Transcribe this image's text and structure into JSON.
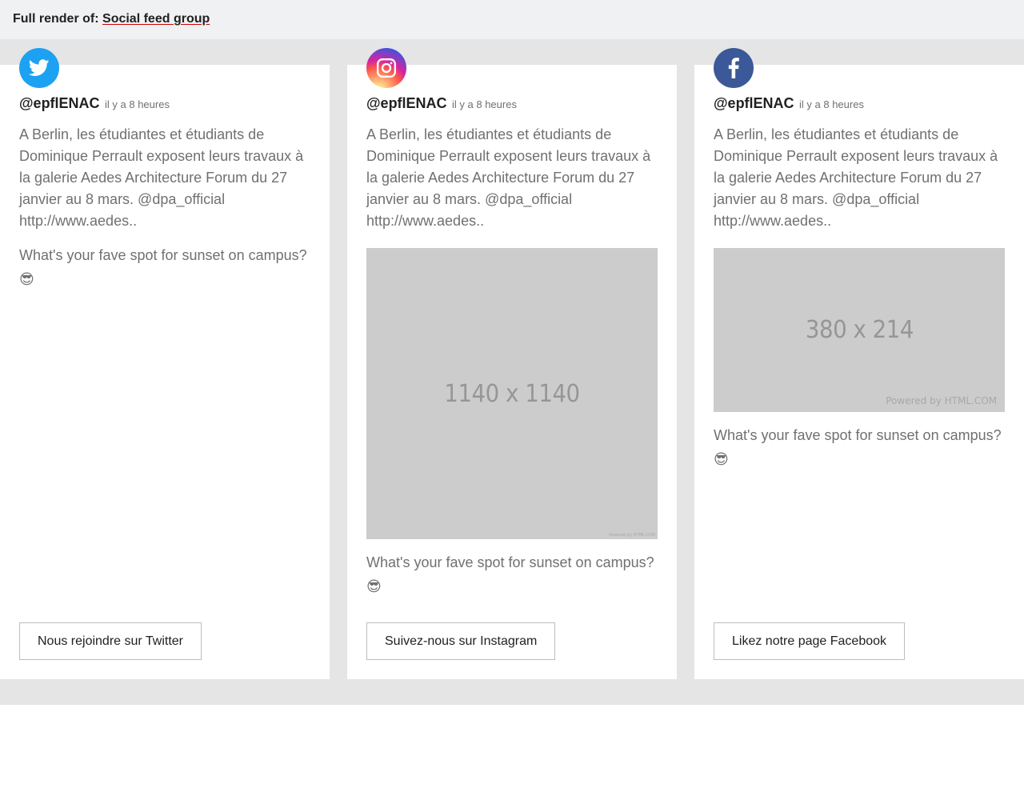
{
  "header": {
    "prefix": "Full render of:",
    "link": "Social feed group"
  },
  "cards": [
    {
      "network": "twitter",
      "handle": "@epflENAC",
      "time": "il y a 8 heures",
      "text": "A Berlin, les étudiantes et étudiants de Dominique Perrault exposent leurs travaux à la galerie Aedes Architecture Forum du 27 janvier au 8 mars. @dpa_official http://www.aedes..",
      "text2": "What's your fave spot for sunset on campus?",
      "button": "Nous rejoindre sur Twitter"
    },
    {
      "network": "instagram",
      "handle": "@epflENAC",
      "time": "il y a 8 heures",
      "text": "A Berlin, les étudiantes et étudiants de Dominique Perrault exposent leurs travaux à la galerie Aedes Architecture Forum du 27 janvier au 8 mars. @dpa_official http://www.aedes..",
      "image_label": "1140 x 1140",
      "image_powered": "Powered by HTML.COM",
      "text2": "What's your fave spot for sunset on campus?",
      "button": "Suivez-nous sur Instagram"
    },
    {
      "network": "facebook",
      "handle": "@epflENAC",
      "time": "il y a 8 heures",
      "text": "A Berlin, les étudiantes et étudiants de Dominique Perrault exposent leurs travaux à la galerie Aedes Architecture Forum du 27 janvier au 8 mars. @dpa_official http://www.aedes..",
      "image_label": "380 x 214",
      "image_powered": "Powered by HTML.COM",
      "text2": "What's your fave spot for sunset on campus?",
      "button": "Likez notre page Facebook"
    }
  ],
  "icons": {
    "twitter": "twitter-bird-icon",
    "instagram": "instagram-camera-icon",
    "facebook": "facebook-f-icon",
    "emoji": "sunglasses-emoji"
  },
  "colors": {
    "twitter": "#1da1f2",
    "facebook": "#3b5998",
    "placeholder": "#cccccc",
    "group_bg": "#e5e5e5"
  }
}
